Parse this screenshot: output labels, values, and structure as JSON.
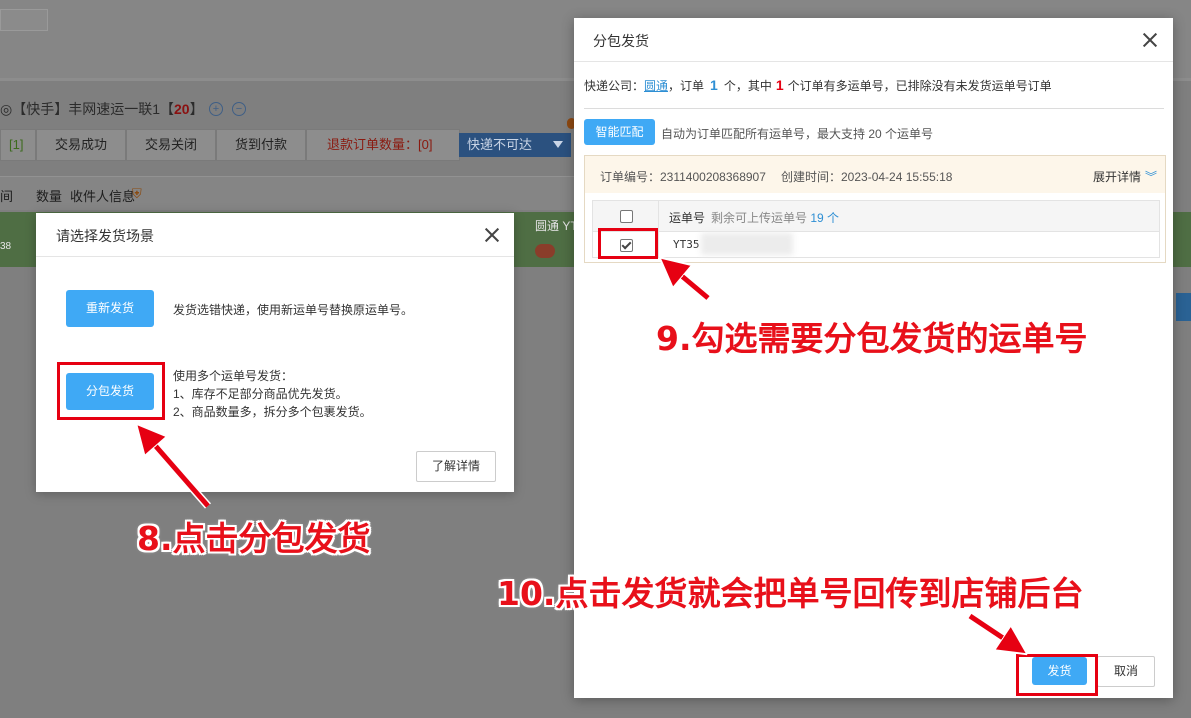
{
  "background": {
    "shop": {
      "badge": "快手",
      "name": "丰网速运一联1",
      "count": "20"
    },
    "tabs": [
      {
        "label": "[1]",
        "style": "green"
      },
      {
        "label": "交易成功",
        "style": ""
      },
      {
        "label": "交易关闭",
        "style": ""
      },
      {
        "label": "货到付款",
        "style": ""
      },
      {
        "label": "退款订单数量：[0]",
        "style": "red"
      }
    ],
    "select_value": "快递不可达",
    "header_cols": [
      "间",
      "数量",
      "收件人信息"
    ],
    "row_left_text": "38",
    "row_courier_text": "圆通 YT"
  },
  "scene_modal": {
    "title": "请选择发货场景",
    "reship_button": "重新发货",
    "reship_desc": "发货选错快递，使用新运单号替换原运单号。",
    "split_button": "分包发货",
    "split_desc_lines": [
      "使用多个运单号发货：",
      "1、库存不足部分商品优先发货。",
      "2、商品数量多，拆分多个包裹发货。"
    ],
    "details_button": "了解详情"
  },
  "split_modal": {
    "title": "分包发货",
    "info": {
      "courier_prefix": "快递公司：",
      "courier": "圆通",
      "orders_prefix": "，订单",
      "orders": "1",
      "orders_mid": "个，其中",
      "multi": "1",
      "suffix": "个订单有多运单号，已排除没有未发货运单号订单"
    },
    "smart_button": "智能匹配",
    "smart_desc": "自动为订单匹配所有运单号，最大支持 20 个运单号",
    "order_no": "订单编号：2311400208368907",
    "created": "创建时间：2023-04-24 15:55:18",
    "expand": "展开详情",
    "table": {
      "col_label": "运单号",
      "remaining_label": "剩余可上传运单号",
      "remaining_count": "19 个",
      "row_value": "YT35",
      "row_checked": true
    },
    "ship_button": "发货",
    "cancel_button": "取消"
  },
  "annotations": {
    "step8": "8.点击分包发货",
    "step9": "9.勾选需要分包发货的运单号",
    "step10": "10.点击发货就会把单号回传到店铺后台"
  },
  "colors": {
    "accent": "#3fa9f5",
    "annotation": "#e60012",
    "link": "#2e8fd4"
  }
}
